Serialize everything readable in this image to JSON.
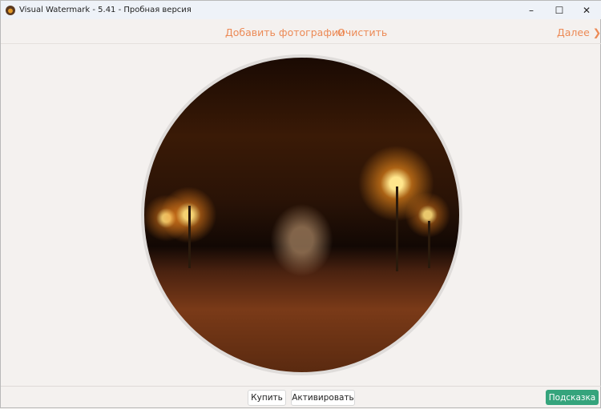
{
  "window": {
    "title": "Visual Watermark - 5.41 - Пробная версия",
    "minimize": "–",
    "maximize": "☐",
    "close": "✕"
  },
  "toolbar": {
    "add_photos": "Добавить фотографии",
    "clear": "Очистить",
    "next": "Далее",
    "next_icon": "❯"
  },
  "colors": {
    "accent": "#ec8a56",
    "hint_button": "#35a47c"
  },
  "footer": {
    "buy": "Купить",
    "activate": "Активировать",
    "hint": "Подсказка"
  }
}
